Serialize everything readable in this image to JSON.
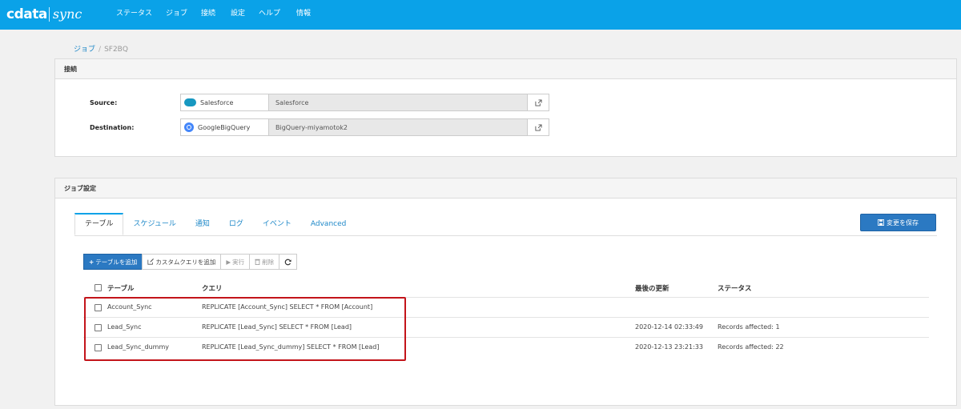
{
  "brand": {
    "cdata": "cdata",
    "sync": "sync"
  },
  "nav": [
    "ステータス",
    "ジョブ",
    "接続",
    "設定",
    "ヘルプ",
    "情報"
  ],
  "breadcrumb": {
    "parent": "ジョブ",
    "separator": "/",
    "current": "SF2BQ"
  },
  "connection_panel": {
    "title": "接続",
    "source_label": "Source:",
    "source_name": "Salesforce",
    "source_value": "Salesforce",
    "destination_label": "Destination:",
    "destination_name": "GoogleBigQuery",
    "destination_value": "BigQuery-miyamotok2"
  },
  "job_panel": {
    "title": "ジョブ設定",
    "tabs": [
      "テーブル",
      "スケジュール",
      "通知",
      "ログ",
      "イベント",
      "Advanced"
    ],
    "save_label": "変更を保存",
    "toolbar": {
      "add_table": "テーブルを追加",
      "add_custom_query": "カスタムクエリを追加",
      "run": "実行",
      "delete": "削除"
    },
    "columns": [
      "テーブル",
      "クエリ",
      "最後の更新",
      "ステータス"
    ],
    "rows": [
      {
        "table": "Account_Sync",
        "query": "REPLICATE [Account_Sync] SELECT * FROM [Account]",
        "updated": "",
        "status": ""
      },
      {
        "table": "Lead_Sync",
        "query": "REPLICATE [Lead_Sync] SELECT * FROM [Lead]",
        "updated": "2020-12-14 02:33:49",
        "status": "Records affected: 1"
      },
      {
        "table": "Lead_Sync_dummy",
        "query": "REPLICATE [Lead_Sync_dummy] SELECT * FROM [Lead]",
        "updated": "2020-12-13 23:21:33",
        "status": "Records affected: 22"
      }
    ]
  },
  "colors": {
    "nav_bg": "#0aa2e8",
    "primary_button": "#2b79c2",
    "highlight": "#c3141a"
  }
}
